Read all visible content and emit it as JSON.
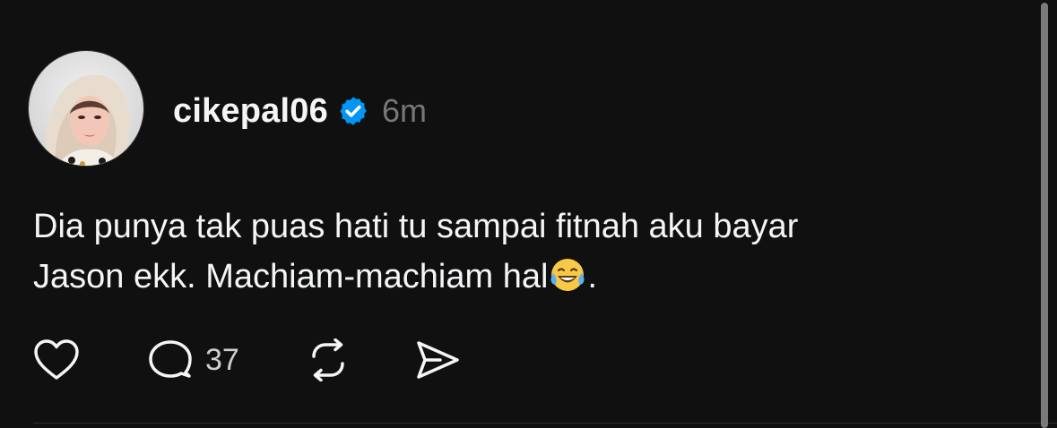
{
  "post": {
    "username": "cikepal06",
    "verified": true,
    "time": "6m",
    "text_line1": "Dia punya tak puas hati tu sampai fitnah aku bayar",
    "text_line2_before_emoji": "Jason ekk. Machiam-machiam hal",
    "emoji": "face-with-tears-of-joy",
    "text_line2_after_emoji": "."
  },
  "actions": {
    "reply_count": "37"
  },
  "colors": {
    "background": "#101010",
    "text": "#f3f5f7",
    "muted": "#777777",
    "verified_blue": "#0095f6"
  },
  "icons": [
    "heart-icon",
    "comment-icon",
    "repost-icon",
    "share-icon",
    "verified-badge-icon"
  ]
}
